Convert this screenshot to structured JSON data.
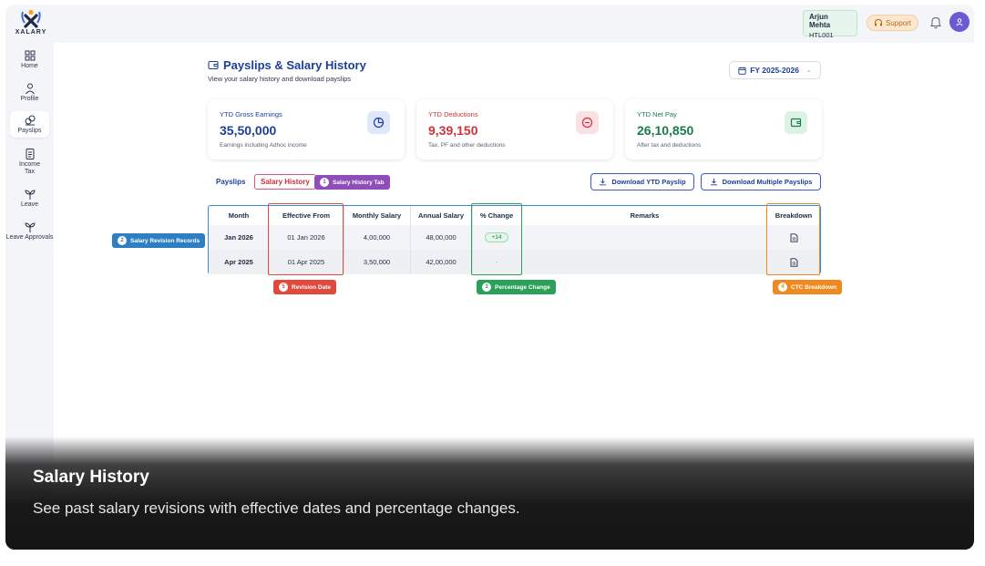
{
  "brand": {
    "name": "XALARY"
  },
  "sidebar": {
    "items": [
      {
        "label": "Home",
        "icon": "grid-icon"
      },
      {
        "label": "Profile",
        "icon": "person-icon"
      },
      {
        "label": "Payslips",
        "icon": "coins-icon",
        "active": true
      },
      {
        "label": "Income Tax",
        "icon": "document-icon"
      },
      {
        "label": "Leave",
        "icon": "plant-icon"
      },
      {
        "label": "Leave Approvals",
        "icon": "plant-check-icon"
      }
    ]
  },
  "topbar": {
    "user_name": "Arjun Mehta",
    "user_id": "HTL001",
    "support_label": "Support"
  },
  "page": {
    "title": "Payslips & Salary History",
    "subtitle": "View your salary history and download payslips",
    "fy_label": "FY 2025-2026"
  },
  "cards": [
    {
      "label": "YTD Gross Earnings",
      "value": "35,50,000",
      "sub": "Earnings including Adhoc income",
      "color": "#1d3f9a",
      "icon": "pie-chart-icon"
    },
    {
      "label": "YTD Deductions",
      "value": "9,39,150",
      "sub": "Tax, PF and other deductions",
      "color": "#d0323c",
      "icon": "minus-circle-icon"
    },
    {
      "label": "YTD Net Pay",
      "value": "26,10,850",
      "sub": "After tax and deductions",
      "color": "#1b7a4a",
      "icon": "wallet-icon"
    }
  ],
  "tabs": {
    "payslips": "Payslips",
    "history": "Salary History"
  },
  "buttons": {
    "download_ytd": "Download YTD Payslip",
    "download_multiple": "Download Multiple Payslips"
  },
  "callouts": {
    "c1": {
      "num": "1",
      "label": "Salary History Tab",
      "color": "#8e4db8"
    },
    "c2": {
      "num": "2",
      "label": "Salary Revision Records",
      "color": "#2d7fc1"
    },
    "c3": {
      "num": "3",
      "label": "Percentage Change",
      "color": "#2aa058"
    },
    "c4": {
      "num": "4",
      "label": "CTC Breakdown",
      "color": "#ee8a1f"
    },
    "c5": {
      "num": "5",
      "label": "Revision Date",
      "color": "#e04a3c"
    }
  },
  "table": {
    "headers": [
      "Month",
      "Effective From",
      "Monthly Salary",
      "Annual Salary",
      "% Change",
      "Remarks",
      "Breakdown"
    ],
    "rows": [
      {
        "month": "Jan 2026",
        "effective": "01 Jan 2026",
        "monthly": "4,00,000",
        "annual": "48,00,000",
        "change": "+14",
        "remarks": ""
      },
      {
        "month": "Apr 2025",
        "effective": "01 Apr 2025",
        "monthly": "3,50,000",
        "annual": "42,00,000",
        "change": "-",
        "remarks": ""
      }
    ]
  },
  "overlay": {
    "title": "Salary History",
    "description": "See past salary revisions with effective dates and percentage changes."
  }
}
